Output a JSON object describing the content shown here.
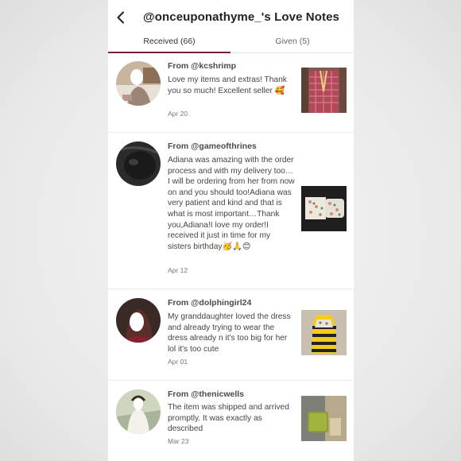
{
  "header": {
    "title": "@onceuponathyme_'s Love Notes"
  },
  "tabs": [
    {
      "label": "Received (66)",
      "active": true
    },
    {
      "label": "Given (5)",
      "active": false
    }
  ],
  "colors": {
    "accent": "#7a1f3d",
    "text": "#444444",
    "divider": "#ececec"
  },
  "notes": [
    {
      "from": "From @kcshrimp",
      "text": "Love my items and extras! Thank you so much! Excellent seller 🥰",
      "date": "Apr 20"
    },
    {
      "from": "From @gameofthrines",
      "text": "Adiana was amazing with the order process and with my delivery too…I will be ordering from her from now on and you should too!Adiana was very patient and kind and that is what is most important…Thank you,Adiana!I love my order!I received it just in time for my sisters birthday🥳🙏😊",
      "date": "Apr 12"
    },
    {
      "from": "From @dolphingirl24",
      "text": "My granddaughter loved the dress and already trying to wear the dress already n it's too big for her lol it's too cute",
      "date": "Apr 01"
    },
    {
      "from": "From @thenicwells",
      "text": "The item was shipped and arrived promptly. It was exactly as described",
      "date": "Mar 23"
    }
  ]
}
